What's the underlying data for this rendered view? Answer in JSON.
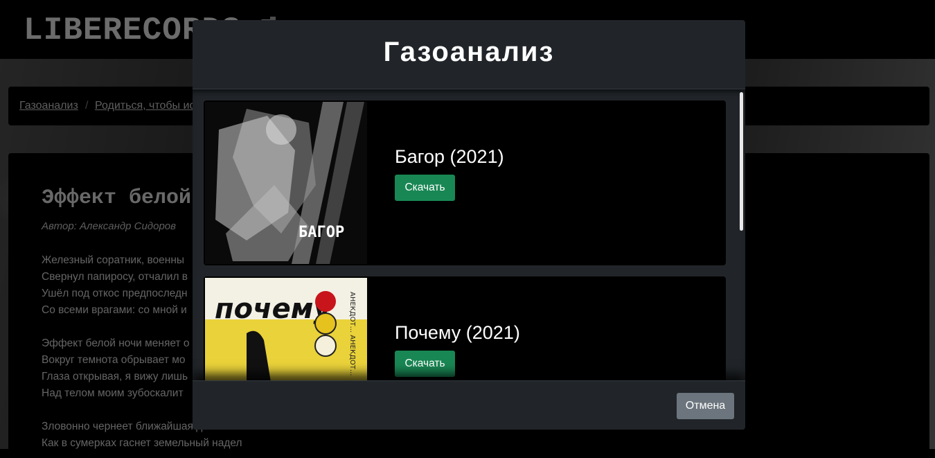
{
  "site": {
    "logo": "LIBERECORDS"
  },
  "breadcrumb": {
    "items": [
      "Газоанализ",
      "Родиться, чтобы ис"
    ],
    "separator": "/"
  },
  "song": {
    "title": "Эффект белой",
    "author": "Автор: Александр Сидоров",
    "lines": [
      "Железный соратник, военны",
      "Свернул папиросу, отчалил в",
      "Ушёл под откос предпоследн",
      "Со всеми врагами: со мной и",
      "",
      "Эффект белой ночи меняет о",
      "Вокруг темнота обрывает мо",
      "Глаза открывая, я вижу лишь",
      "Над телом моим зубоскалит",
      "",
      "Зловонно чернеет ближайшая даль",
      "Как в сумерках гаснет земельный надел"
    ]
  },
  "modal": {
    "title": "Газоанализ",
    "albums": [
      {
        "name": "Багор (2021)",
        "download_label": "Скачать",
        "cover_text": "БАГОР"
      },
      {
        "name": "Почему (2021)",
        "download_label": "Скачать",
        "cover_text": "почему",
        "cover_side_text": "АНЕКДОТ... АНЕКДОТ..."
      }
    ],
    "cancel_label": "Отмена"
  },
  "colors": {
    "modal_bg": "#212529",
    "download_button": "#198754",
    "cancel_button": "#6c757d",
    "card_bg": "#000000"
  }
}
